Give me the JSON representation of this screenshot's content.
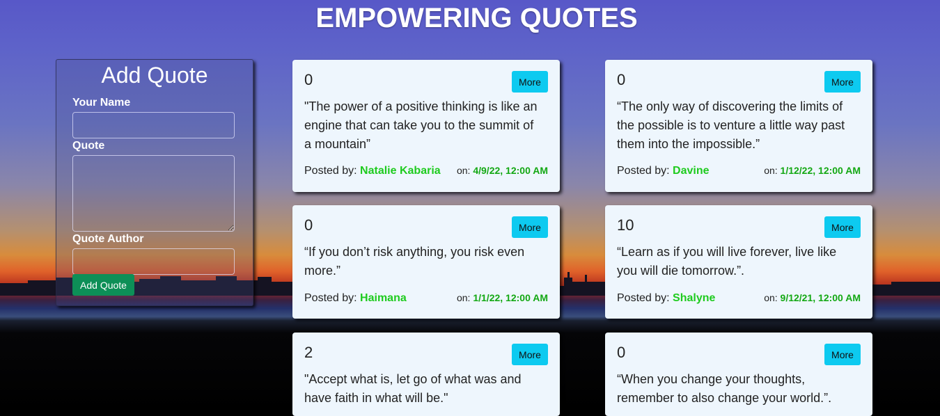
{
  "page": {
    "title": "EMPOWERING QUOTES"
  },
  "form": {
    "heading": "Add Quote",
    "name_label": "Your Name",
    "name_value": "",
    "quote_label": "Quote",
    "quote_value": "",
    "author_label": "Quote Author",
    "author_value": "",
    "submit_label": "Add Quote"
  },
  "quotes": [
    {
      "votes": "0",
      "more_label": "More",
      "text": "\"The power of a positive thinking is like an engine that can take you to the summit of a mountain”",
      "posted_label": "Posted by: ",
      "author": "Natalie Kabaria",
      "on_label": "on: ",
      "date": "4/9/22, 12:00 AM"
    },
    {
      "votes": "0",
      "more_label": "More",
      "text": "“The only way of discovering the limits of the possible is to venture a little way past them into the impossible.”",
      "posted_label": "Posted by: ",
      "author": "Davine",
      "on_label": "on: ",
      "date": "1/12/22, 12:00 AM"
    },
    {
      "votes": "0",
      "more_label": "More",
      "text": "“If you don’t risk anything, you risk even more.”",
      "posted_label": "Posted by: ",
      "author": "Haimana",
      "on_label": "on: ",
      "date": "1/1/22, 12:00 AM"
    },
    {
      "votes": "10",
      "more_label": "More",
      "text": "“Learn as if you will live forever, live like you will die tomorrow.”.",
      "posted_label": "Posted by: ",
      "author": "Shalyne",
      "on_label": "on: ",
      "date": "9/12/21, 12:00 AM"
    },
    {
      "votes": "2",
      "more_label": "More",
      "text": "\"Accept what is, let go of what was and have faith in what will be.\"",
      "posted_label": "",
      "author": "",
      "on_label": "",
      "date": ""
    },
    {
      "votes": "0",
      "more_label": "More",
      "text": "“When you change your thoughts, remember to also change your world.”.",
      "posted_label": "",
      "author": "",
      "on_label": "",
      "date": ""
    }
  ],
  "colors": {
    "accent_more": "#0dcaf0",
    "accent_add": "#0d8f57",
    "author": "#1ecb1e",
    "date": "#13a813",
    "card_bg": "#eef6fd"
  }
}
